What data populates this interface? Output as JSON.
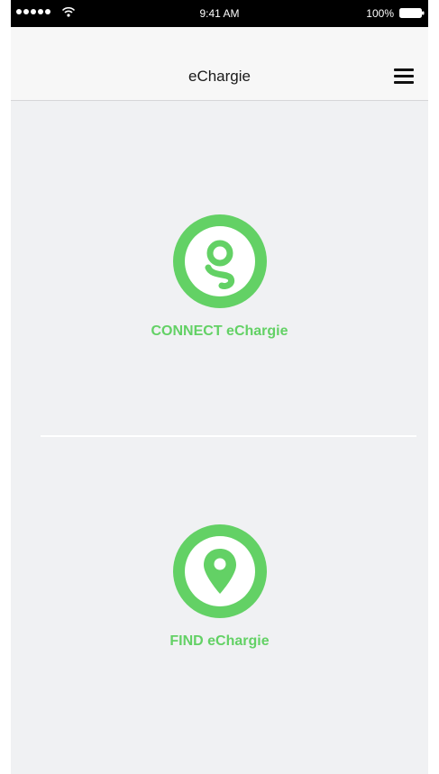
{
  "status_bar": {
    "time": "9:41 AM",
    "battery": "100%"
  },
  "nav": {
    "title": "eChargie",
    "menu_icon": "hamburger-menu-icon"
  },
  "actions": [
    {
      "label": "CONNECT eChargie",
      "icon": "echargie-logo-icon"
    },
    {
      "label": "FIND eChargie",
      "icon": "map-pin-icon"
    }
  ],
  "colors": {
    "accent": "#63d165",
    "background": "#f0f1f3",
    "nav_background": "#f7f7f7"
  }
}
